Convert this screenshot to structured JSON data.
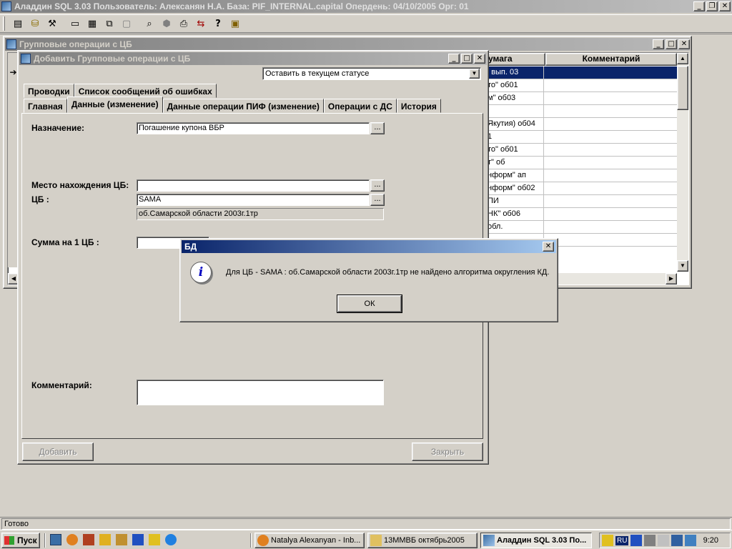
{
  "app": {
    "title": "Аладдин SQL 3.03 Пользователь: Алексанян Н.А. База: PIF_INTERNAL.capital Опердень: 04/10/2005 Орг: 01",
    "status": "Готово"
  },
  "toolbar": {
    "icons": [
      "document-icon",
      "database-icon",
      "tools-icon",
      "window-icon",
      "tile-icon",
      "cascade-icon",
      "minimize-all-icon",
      "binoculars-icon",
      "stop-icon",
      "print-icon",
      "exchange-icon",
      "help-icon",
      "plugin-icon"
    ]
  },
  "bgwindow": {
    "title": "Групповые операции с ЦБ",
    "columns": [
      "умага",
      "Комментарий"
    ],
    "rows": [
      "' вып. 03",
      "то\" об01",
      "м\" об03",
      "",
      "Якутия) об04",
      "1",
      "то\" об01",
      "т\" об",
      "нформ\" ап",
      "нформ\" об02",
      "ПИ",
      "НК\" об06",
      "обл.",
      ""
    ]
  },
  "dialog": {
    "title": "Добавить Групповые операции с ЦБ",
    "status_select": "Оставить в текущем статусе",
    "tabs_back": [
      "Проводки",
      "Список сообщений об ошибках"
    ],
    "tabs_front": [
      "Главная",
      "Данные (изменение)",
      "Данные операции ПИФ (изменение)",
      "Операции с ДС",
      "История"
    ],
    "labels": {
      "purpose": "Назначение:",
      "location": "Место нахождения ЦБ:",
      "cb": "ЦБ :",
      "sum": "Сумма на 1 ЦБ :",
      "comment": "Комментарий:"
    },
    "values": {
      "purpose": "Погашение купона ВБР",
      "location": "",
      "cb": "SAMA",
      "cb_desc": "об.Самарской области 2003г.1тр",
      "sum": "",
      "comment": ""
    },
    "dots": "...",
    "add_button": "Добавить",
    "close_button": "Закрыть"
  },
  "msgbox": {
    "title": "БД",
    "message": "Для ЦБ - SAMA : об.Самарской области 2003г.1тр не найдено алгоритма округления КД.",
    "ok": "ОК"
  },
  "taskbar": {
    "start": "Пуск",
    "tasks": [
      "Natalya Alexanyan - Inb...",
      "13ММВБ октябрь2005",
      "Аладдин SQL 3.03 По..."
    ],
    "lang": "RU",
    "clock": "9:20"
  }
}
